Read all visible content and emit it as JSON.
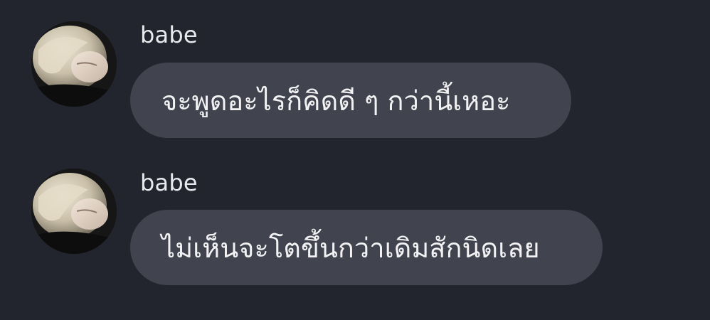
{
  "conversation": {
    "messages": [
      {
        "sender": "babe",
        "avatar_icon": "profile-photo-blonde-person",
        "text": "จะพูดอะไรก็คิดดี ๆ กว่านี้เหอะ"
      },
      {
        "sender": "babe",
        "avatar_icon": "profile-photo-blonde-person",
        "text": "ไม่เห็นจะโตขึ้นกว่าเดิมสักนิดเลย"
      }
    ]
  },
  "colors": {
    "background": "#22252e",
    "bubble": "#41444e",
    "text": "#f2f2f4"
  }
}
